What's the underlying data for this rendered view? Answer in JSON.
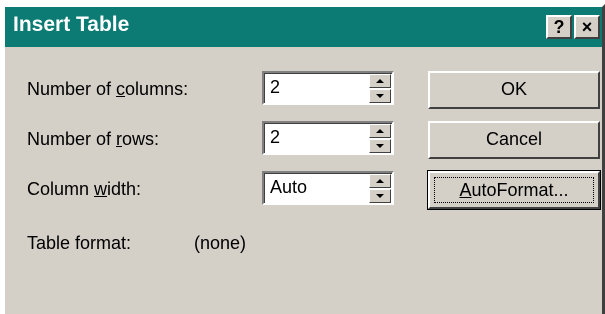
{
  "window": {
    "title": "Insert Table",
    "help_glyph": "?",
    "close_glyph": "×",
    "titlebar_color": "#0c7b74",
    "face_color": "#d4d0c8"
  },
  "fields": {
    "columns": {
      "label_pre": "Number of ",
      "label_key": "c",
      "label_post": "olumns:",
      "value": "2"
    },
    "rows": {
      "label_pre": "Number of ",
      "label_key": "r",
      "label_post": "ows:",
      "value": "2"
    },
    "width": {
      "label_pre": "Column ",
      "label_key": "w",
      "label_post": "idth:",
      "value": "Auto"
    }
  },
  "table_format": {
    "label": "Table format:",
    "value": "(none)"
  },
  "buttons": {
    "ok": "OK",
    "cancel": "Cancel",
    "autoformat_key": "A",
    "autoformat_rest": "utoFormat..."
  }
}
